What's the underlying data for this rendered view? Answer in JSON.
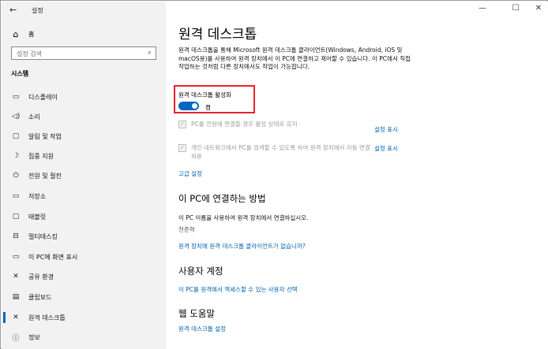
{
  "window": {
    "title": "설정",
    "back": "←",
    "minimize": "—",
    "maximize": "☐",
    "close": "✕"
  },
  "sidebar": {
    "home_label": "홈",
    "search_placeholder": "설정 검색",
    "section": "시스템",
    "items": [
      {
        "label": "디스플레이",
        "icon": "▭"
      },
      {
        "label": "소리",
        "icon": "◁)"
      },
      {
        "label": "알림 및 작업",
        "icon": "▢"
      },
      {
        "label": "집중 지원",
        "icon": "☽"
      },
      {
        "label": "전원 및 절전",
        "icon": "⏻"
      },
      {
        "label": "저장소",
        "icon": "▭"
      },
      {
        "label": "태블릿",
        "icon": "▢"
      },
      {
        "label": "멀티태스킹",
        "icon": "⊟"
      },
      {
        "label": "이 PC에 화면 표시",
        "icon": "▭"
      },
      {
        "label": "공유 환경",
        "icon": "✕"
      },
      {
        "label": "클립보드",
        "icon": "▤"
      },
      {
        "label": "원격 데스크톱",
        "icon": "✕"
      },
      {
        "label": "정보",
        "icon": "ⓘ"
      }
    ]
  },
  "main": {
    "title": "원격 데스크톱",
    "description": "원격 데스크톱을 통해 Microsoft 원격 데스크톱 클라이언트(Windows, Android, iOS 및 macOS용)를 사용하여 원격 장치에서 이 PC에 연결하고 제어할 수 있습니다. 이 PC에서 직접 작업하는 것처럼 다른 장치에서도 작업이 가능합니다.",
    "enable_label": "원격 데스크톱 활성화",
    "toggle_state": "켬",
    "checkbox1": "PC를 전원에 연결할 경우 활성 상태로 유지",
    "checkbox2": "개인 네트워크에서 PC를 검색할 수 있도록 하여 원격 장치에서 자동 연결 허용",
    "show_settings": "설정 표시",
    "advanced_settings": "고급 설정",
    "connect_heading": "이 PC에 연결하는 방법",
    "connect_text": "이 PC 이름을 사용하여 원격 장치에서 연결하십시오.",
    "pc_name": "천준혁",
    "no_client_link": "원격 장치에 원격 데스크톱 클라이언트가 없습니까?",
    "accounts_heading": "사용자 계정",
    "accounts_link": "이 PC를 원격에서 액세스할 수 있는 사용자 선택",
    "help_heading": "웹 도움말",
    "help_link": "원격 데스크톱 설정"
  }
}
